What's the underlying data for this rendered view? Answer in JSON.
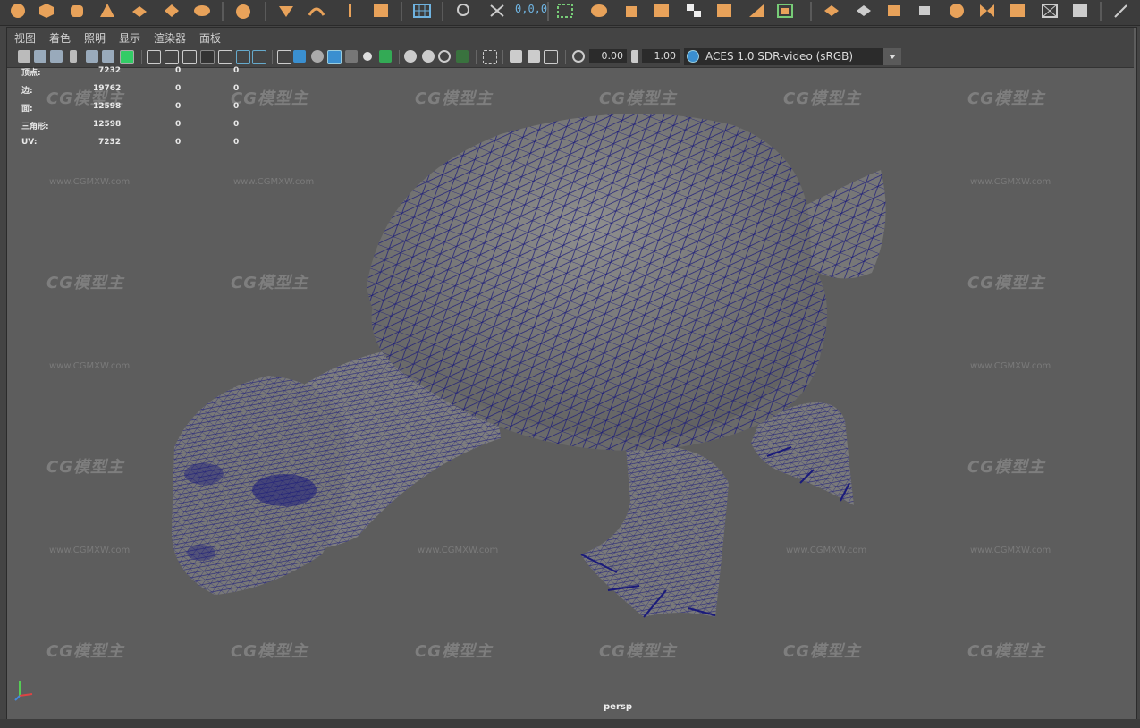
{
  "shelf": {
    "coord_readout": "0,0,0",
    "accent": "#e8a25a",
    "icons": [
      "sphere-icon",
      "cube-icon",
      "cylinder-icon",
      "cone-icon",
      "plane-icon",
      "torus-icon",
      "pipe-icon",
      "sculpt-icon",
      "lattice-icon",
      "bend-icon",
      "joint-icon",
      "text-icon",
      "box-icon",
      "grid-icon",
      "magnet-icon",
      "snap-icon",
      "bounding-box-icon",
      "mesh-icon",
      "paint-icon",
      "uv-icon",
      "checker-icon",
      "render-icon",
      "bevel-icon",
      "extrude-icon",
      "bridge-icon",
      "append-icon",
      "merge-icon",
      "render-view-icon",
      "pen-icon"
    ]
  },
  "menubar": {
    "items": [
      "视图",
      "着色",
      "照明",
      "显示",
      "渲染器",
      "面板"
    ]
  },
  "toolbar": {
    "exposure": "0.00",
    "gamma": "1.00",
    "color_space": "ACES 1.0 SDR-video (sRGB)"
  },
  "hud": {
    "rows": [
      {
        "label": "顶点:",
        "v1": "7232",
        "v2": "0",
        "v3": "0"
      },
      {
        "label": "边:",
        "v1": "19762",
        "v2": "0",
        "v3": "0"
      },
      {
        "label": "面:",
        "v1": "12598",
        "v2": "0",
        "v3": "0"
      },
      {
        "label": "三角形:",
        "v1": "12598",
        "v2": "0",
        "v3": "0"
      },
      {
        "label": "UV:",
        "v1": "7232",
        "v2": "0",
        "v3": "0"
      }
    ]
  },
  "watermark": {
    "logo": "CG模型主",
    "url": "www.CGMXW.com"
  },
  "viewport": {
    "camera": "persp",
    "background": "#5d5d5d",
    "wire_color": "#1a1a7a",
    "model": "turtle wireframe mesh"
  }
}
